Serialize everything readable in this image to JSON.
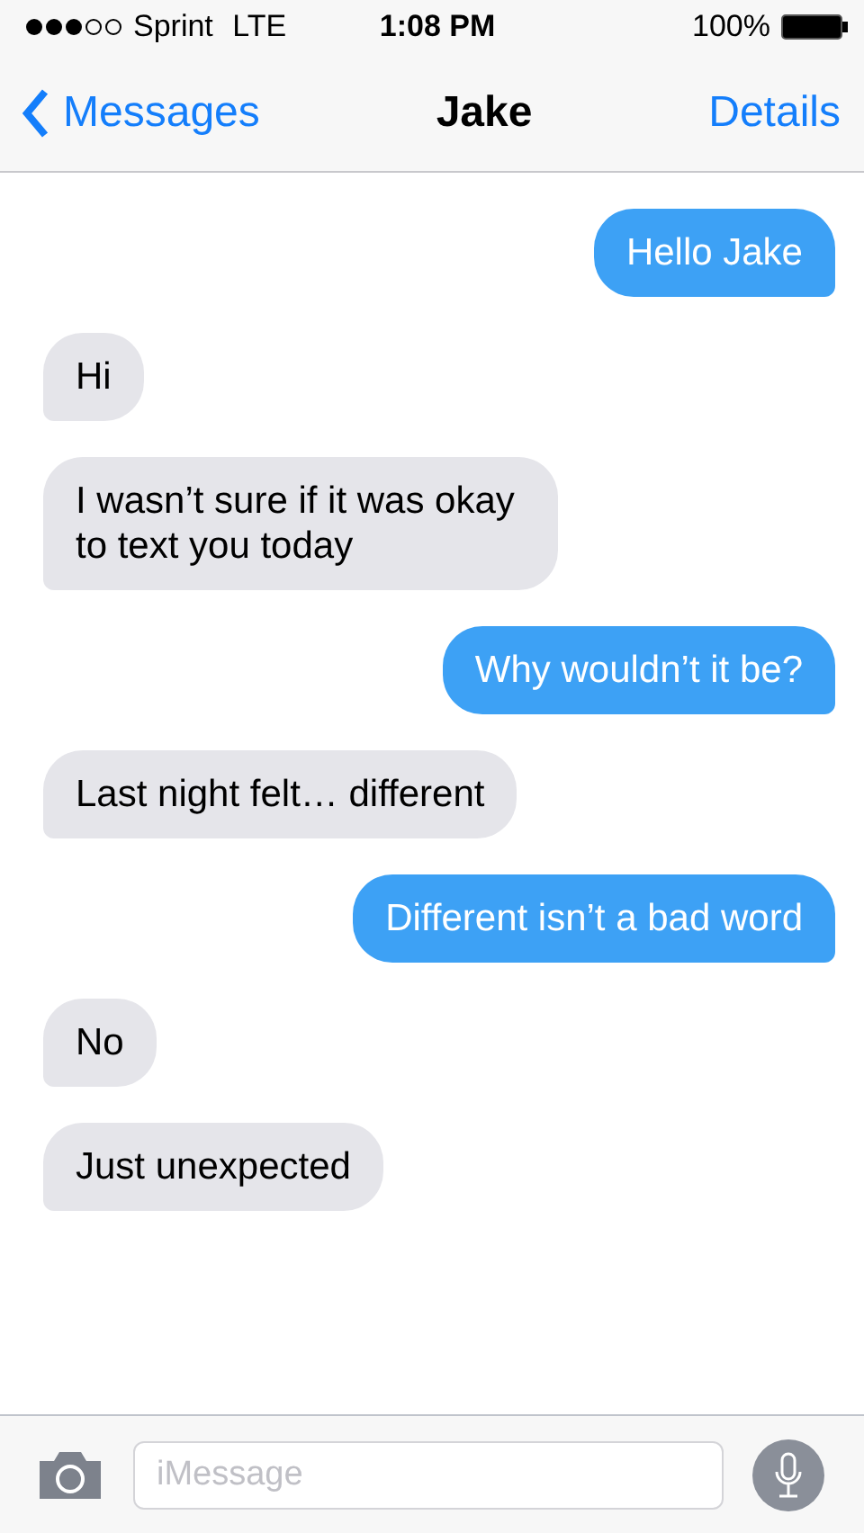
{
  "status_bar": {
    "carrier": "Sprint",
    "network": "LTE",
    "time": "1:08 PM",
    "battery": "100%"
  },
  "nav_bar": {
    "back": "Messages",
    "title": "Jake",
    "action": "Details"
  },
  "messages": [
    {
      "text": "Hello Jake",
      "kind": "sent"
    },
    {
      "text": "Hi",
      "kind": "received"
    },
    {
      "text": "I wasn’t sure if it was okay to text you today",
      "kind": "received"
    },
    {
      "text": "Why wouldn’t it be?",
      "kind": "sent"
    },
    {
      "text": "Last night felt… different",
      "kind": "received"
    },
    {
      "text": "Different isn’t a bad word",
      "kind": "sent"
    },
    {
      "text": "No",
      "kind": "received"
    },
    {
      "text": "Just unexpected",
      "kind": "received"
    }
  ],
  "composer": {
    "placeholder": "iMessage"
  }
}
